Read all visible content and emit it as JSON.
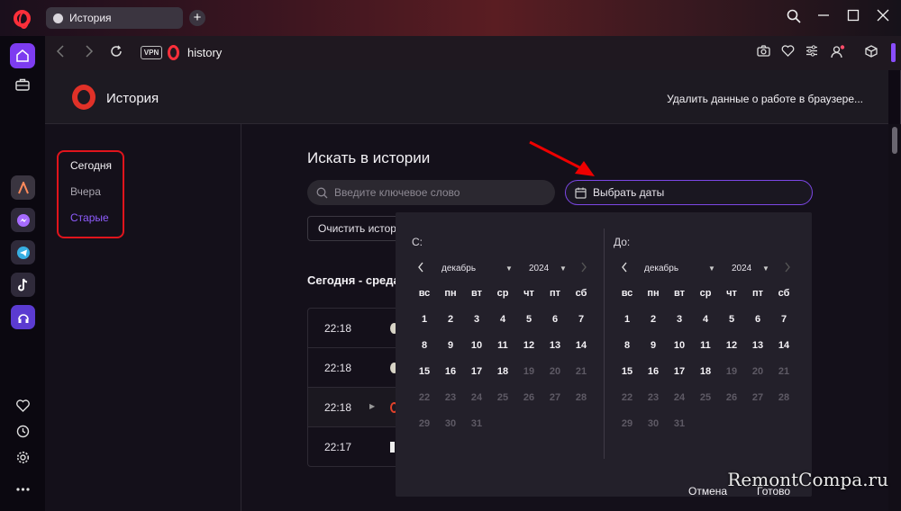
{
  "tab": {
    "title": "История"
  },
  "address": {
    "vpn": "VPN",
    "url": "history"
  },
  "header": {
    "title": "История",
    "clear_data": "Удалить данные о работе в браузере..."
  },
  "nav": {
    "today": "Сегодня",
    "yesterday": "Вчера",
    "older": "Старые"
  },
  "search": {
    "title": "Искать в истории",
    "placeholder": "Введите ключевое слово",
    "date_button": "Выбрать даты"
  },
  "clear_history": "Очистить истор",
  "section_title": "Сегодня - среда",
  "history": [
    {
      "time": "22:18"
    },
    {
      "time": "22:18"
    },
    {
      "time": "22:18"
    },
    {
      "time": "22:17"
    }
  ],
  "calendar": {
    "from_label": "С:",
    "to_label": "До:",
    "month": "декабрь",
    "year": "2024",
    "weekdays": [
      "вс",
      "пн",
      "вт",
      "ср",
      "чт",
      "пт",
      "сб"
    ],
    "weeks": [
      [
        "1",
        "2",
        "3",
        "4",
        "5",
        "6",
        "7"
      ],
      [
        "8",
        "9",
        "10",
        "11",
        "12",
        "13",
        "14"
      ],
      [
        "15",
        "16",
        "17",
        "18",
        "19",
        "20",
        "21"
      ],
      [
        "22",
        "23",
        "24",
        "25",
        "26",
        "27",
        "28"
      ],
      [
        "29",
        "30",
        "31",
        "",
        "",
        "",
        ""
      ]
    ],
    "enabled_upto": 18,
    "cancel": "Отмена",
    "done": "Готово"
  },
  "watermark": "RemontCompa.ru",
  "colors": {
    "accent": "#7d3cf0",
    "highlight_box": "#e0141c",
    "opera_red": "#ff2f3a"
  }
}
